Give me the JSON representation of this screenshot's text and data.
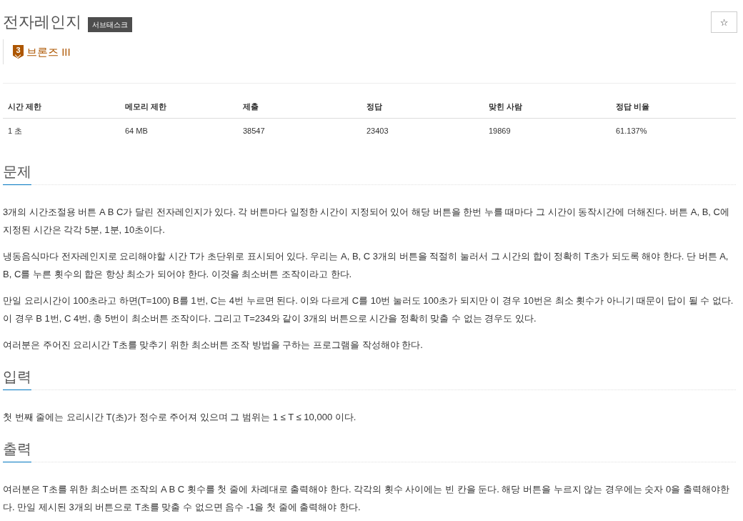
{
  "problem": {
    "title": "전자레인지",
    "badge": "서브태스크",
    "star_button": {
      "label": "☆"
    },
    "tier": {
      "number": "3",
      "name": "브론즈 III"
    }
  },
  "stats": {
    "columns": [
      "시간 제한",
      "메모리 제한",
      "제출",
      "정답",
      "맞힌 사람",
      "정답 비율"
    ],
    "rows": [
      [
        "1 초",
        "64 MB",
        "38547",
        "23403",
        "19869",
        "61.137%"
      ]
    ]
  },
  "sections": [
    {
      "heading": "문제",
      "paragraphs": [
        "3개의 시간조절용 버튼 A B C가 달린 전자레인지가 있다. 각 버튼마다 일정한 시간이 지정되어 있어 해당 버튼을 한번 누를 때마다 그 시간이 동작시간에 더해진다. 버튼 A, B, C에 지정된 시간은 각각 5분, 1분, 10초이다.",
        "냉동음식마다 전자레인지로 요리해야할 시간 T가 초단위로 표시되어 있다. 우리는 A, B, C 3개의 버튼을 적절히 눌러서 그 시간의 합이 정확히 T초가 되도록 해야 한다. 단 버튼 A, B, C를 누른 횟수의 합은 항상 최소가 되어야 한다. 이것을 최소버튼 조작이라고 한다.",
        "만일 요리시간이 100초라고 하면(T=100) B를 1번, C는 4번 누르면 된다. 이와 다르게 C를 10번 눌러도 100초가 되지만 이 경우 10번은 최소 횟수가 아니기 때문이 답이 될 수 없다. 이 경우 B 1번, C 4번, 총 5번이 최소버튼 조작이다. 그리고 T=234와 같이 3개의 버튼으로 시간을 정확히 맞출 수 없는 경우도 있다.",
        "여러분은 주어진 요리시간 T초를 맞추기 위한 최소버튼 조작 방법을 구하는 프로그램을 작성해야 한다."
      ]
    },
    {
      "heading": "입력",
      "paragraphs": [
        "첫 번째 줄에는 요리시간 T(초)가 정수로 주어져 있으며 그 범위는 1 ≤ T ≤ 10,000 이다."
      ]
    },
    {
      "heading": "출력",
      "paragraphs": [
        "여러분은 T초를 위한 최소버튼 조작의 A B C 횟수를 첫 줄에 차례대로 출력해야 한다. 각각의 횟수 사이에는 빈 칸을 둔다. 해당 버튼을 누르지 않는 경우에는 숫자 0을 출력해야한다. 만일 제시된 3개의 버튼으로 T초를 맞출 수 없으면 음수 -1을 첫 줄에 출력해야 한다."
      ]
    }
  ]
}
